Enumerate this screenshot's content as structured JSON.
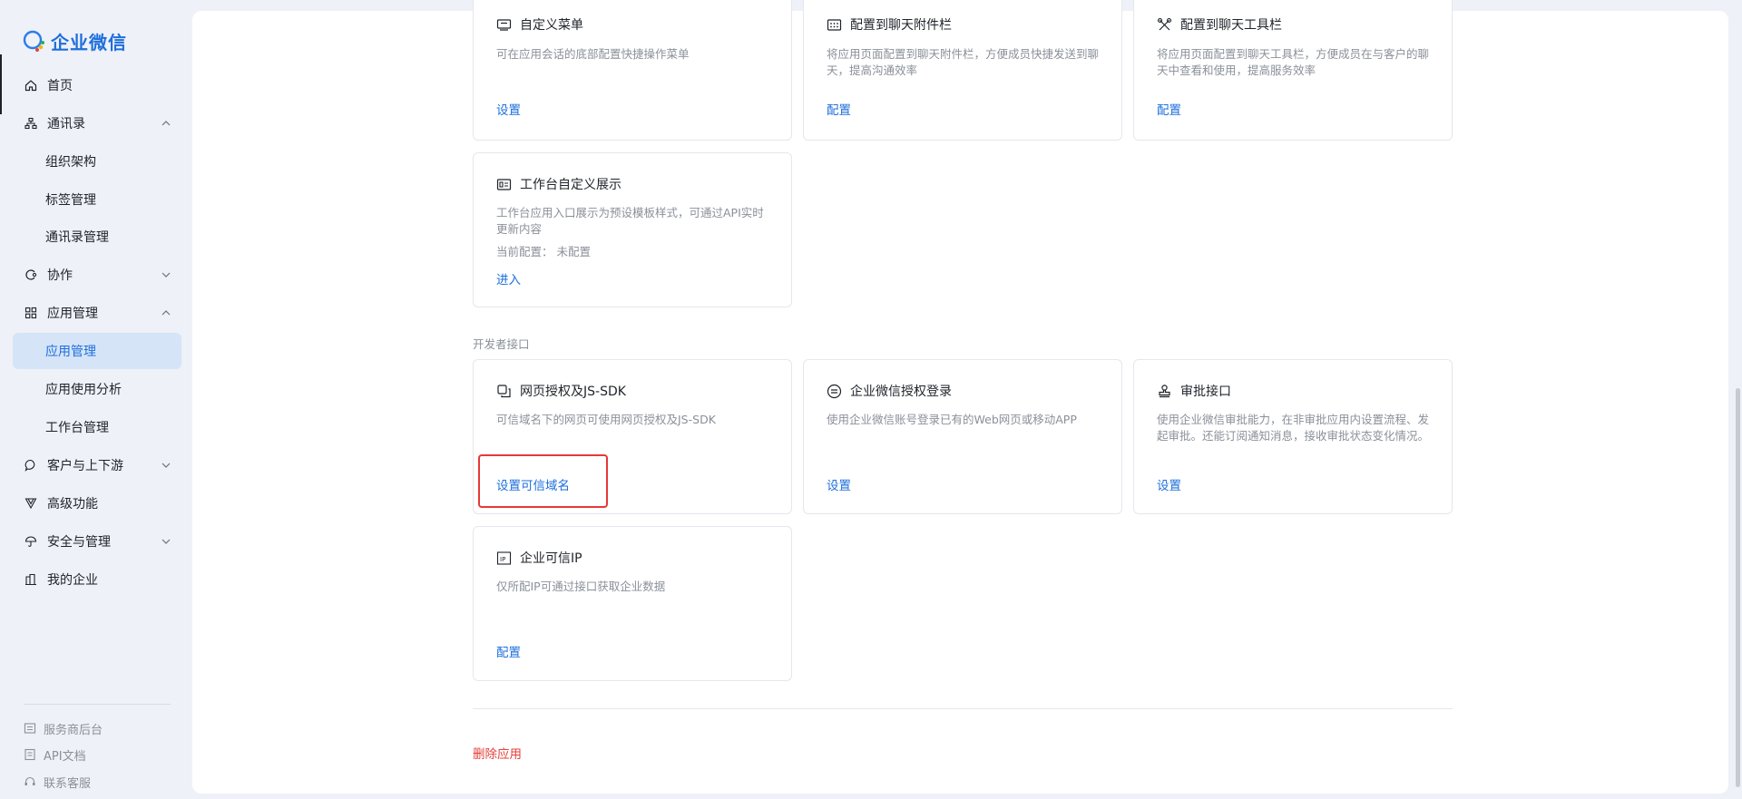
{
  "app": {
    "title": "企业微信"
  },
  "sidebar": {
    "items": [
      {
        "label": "首页",
        "icon": "home-icon"
      },
      {
        "label": "通讯录",
        "icon": "org-icon",
        "expanded": true
      },
      {
        "label": "组织架构"
      },
      {
        "label": "标签管理"
      },
      {
        "label": "通讯录管理"
      },
      {
        "label": "协作",
        "icon": "collab-icon",
        "expanded": false
      },
      {
        "label": "应用管理",
        "icon": "apps-icon",
        "expanded": true
      },
      {
        "label": "应用管理",
        "active": true
      },
      {
        "label": "应用使用分析"
      },
      {
        "label": "工作台管理"
      },
      {
        "label": "客户与上下游",
        "icon": "chat-icon",
        "expanded": false
      },
      {
        "label": "高级功能",
        "icon": "filter-icon"
      },
      {
        "label": "安全与管理",
        "icon": "umbrella-icon",
        "expanded": false
      },
      {
        "label": "我的企业",
        "icon": "building-icon"
      }
    ],
    "footer": [
      {
        "label": "服务商后台",
        "icon": "service-icon"
      },
      {
        "label": "API文档",
        "icon": "doc-icon"
      },
      {
        "label": "联系客服",
        "icon": "headset-icon"
      }
    ]
  },
  "cards_top": [
    {
      "title": "自定义菜单",
      "icon": "menu-icon",
      "desc": "可在应用会话的底部配置快捷操作菜单",
      "link": "设置"
    },
    {
      "title": "配置到聊天附件栏",
      "icon": "grid-icon",
      "desc": "将应用页面配置到聊天附件栏，方便成员快捷发送到聊天，提高沟通效率",
      "link": "配置"
    },
    {
      "title": "配置到聊天工具栏",
      "icon": "tools-icon",
      "desc": "将应用页面配置到聊天工具栏，方便成员在与客户的聊天中查看和使用，提高服务效率",
      "link": "配置"
    }
  ],
  "card_workbench": {
    "title": "工作台自定义展示",
    "icon": "card-icon",
    "desc": "工作台应用入口展示为预设模板样式，可通过API实时更新内容",
    "extra": "当前配置： 未配置",
    "link": "进入"
  },
  "dev_section": {
    "label": "开发者接口"
  },
  "cards_dev": [
    {
      "title": "网页授权及JS-SDK",
      "icon": "copy-icon",
      "desc": "可信域名下的网页可使用网页授权及JS-SDK",
      "link": "设置可信域名"
    },
    {
      "title": "企业微信授权登录",
      "icon": "login-icon",
      "desc": "使用企业微信账号登录已有的Web网页或移动APP",
      "link": "设置"
    },
    {
      "title": "审批接口",
      "icon": "stamp-icon",
      "desc": "使用企业微信审批能力，在非审批应用内设置流程、发起审批。还能订阅通知消息，接收审批状态变化情况。",
      "link": "设置"
    }
  ],
  "card_ip": {
    "title": "企业可信IP",
    "icon": "ip-icon",
    "desc": "仅所配IP可通过接口获取企业数据",
    "link": "配置"
  },
  "delete": {
    "label": "删除应用"
  },
  "colors": {
    "accent": "#1e6fdc",
    "danger": "#e5403b",
    "highlight": "#e53935"
  }
}
